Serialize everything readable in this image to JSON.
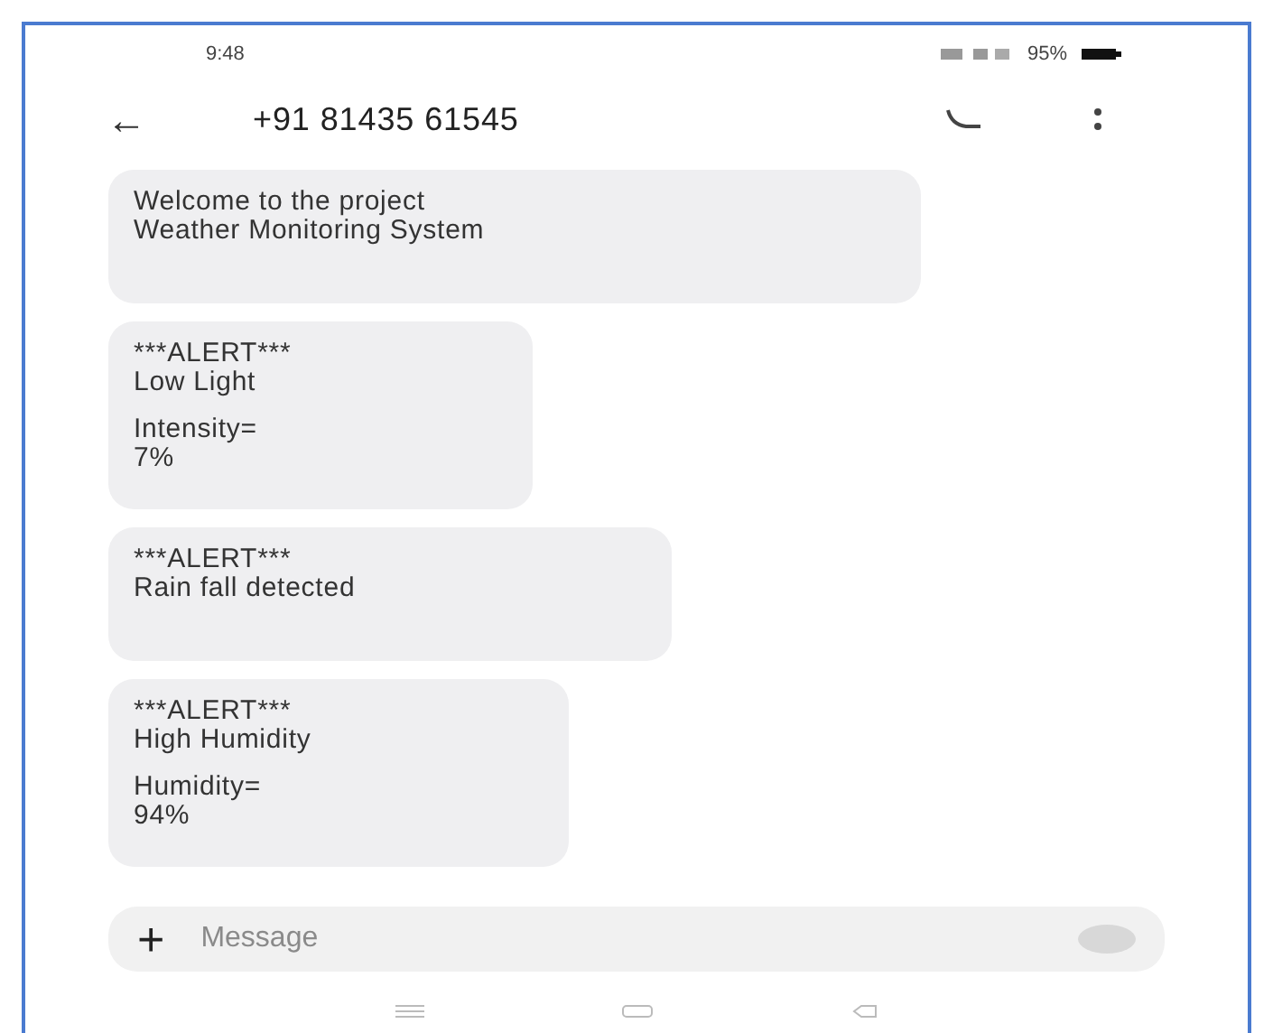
{
  "status_bar": {
    "time": "9:48",
    "battery": "95%"
  },
  "header": {
    "back": "←",
    "title": "+91 81435 61545"
  },
  "messages": [
    {
      "paragraphs": [
        "Welcome to the project\nWeather Monitoring System"
      ]
    },
    {
      "paragraphs": [
        "***ALERT***\nLow Light",
        "Intensity=\n7%"
      ]
    },
    {
      "paragraphs": [
        "***ALERT***\nRain fall detected"
      ]
    },
    {
      "paragraphs": [
        "***ALERT***\nHigh Humidity",
        "Humidity=\n94%"
      ]
    }
  ],
  "composer": {
    "plus": "+",
    "placeholder": "Message"
  }
}
